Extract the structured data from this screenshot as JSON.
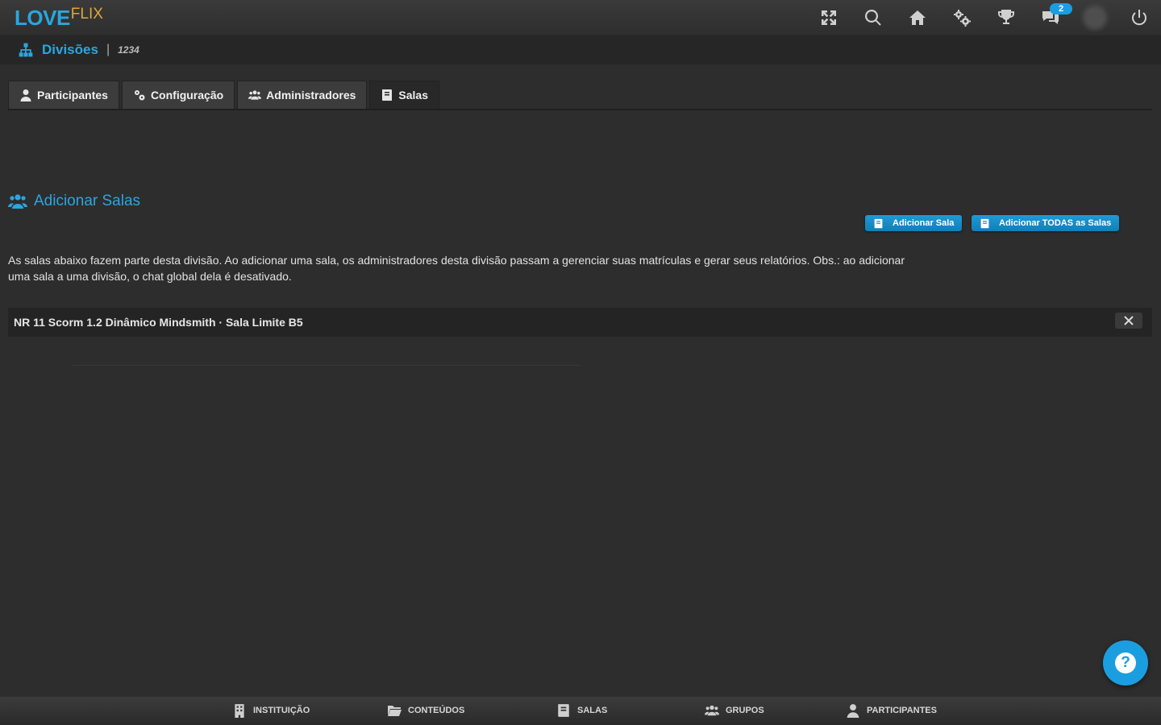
{
  "brand": {
    "part1": "LOVE",
    "part2": "FLIX"
  },
  "topbar": {
    "icons": [
      "fullscreen-icon",
      "search-icon",
      "home-icon",
      "settings-icon",
      "trophy-icon",
      "chat-icon",
      "avatar",
      "power-icon"
    ],
    "chat_badge": "2"
  },
  "breadcrumb": {
    "title": "Divisões",
    "separator": "|",
    "id": "1234"
  },
  "tabs": [
    {
      "label": "Participantes",
      "icon": "user-icon"
    },
    {
      "label": "Configuração",
      "icon": "gears-icon"
    },
    {
      "label": "Administradores",
      "icon": "users-icon"
    },
    {
      "label": "Salas",
      "icon": "book-icon",
      "active": true
    }
  ],
  "section": {
    "title": "Adicionar Salas",
    "add_button": "Adicionar Sala",
    "add_all_button": "Adicionar TODAS as Salas",
    "description": "As salas abaixo fazem parte desta divisão. Ao adicionar uma sala, os administradores desta divisão passam a gerenciar suas matrículas e gerar seus relatórios. Obs.: ao adicionar uma sala a uma divisão, o chat global dela é desativado."
  },
  "rooms": [
    {
      "name": "NR 11 Scorm 1.2 Dinâmico Mindsmith · Sala Limite B5"
    }
  ],
  "help": {
    "label": "?"
  },
  "bottom_nav": [
    {
      "label": "INSTITUIÇÃO",
      "icon": "building-icon"
    },
    {
      "label": "CONTEÚDOS",
      "icon": "folder-icon"
    },
    {
      "label": "SALAS",
      "icon": "book-icon"
    },
    {
      "label": "GRUPOS",
      "icon": "users-icon"
    },
    {
      "label": "PARTICIPANTES",
      "icon": "user-icon"
    }
  ],
  "colors": {
    "accent": "#2aa6df",
    "brand_flix": "#e0a63a",
    "background": "#2d2d2d"
  }
}
